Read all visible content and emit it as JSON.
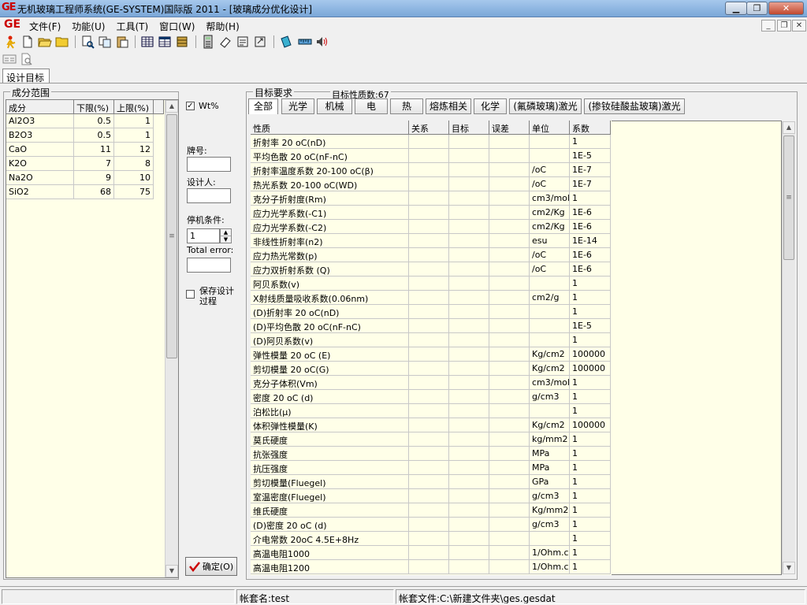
{
  "window": {
    "logo": "GE",
    "title": "无机玻璃工程师系统(GE-SYSTEM)国际版 2011 - [玻璃成分优化设计]"
  },
  "menu": {
    "logo": "GE",
    "items": [
      "文件(F)",
      "功能(U)",
      "工具(T)",
      "窗口(W)",
      "帮助(H)"
    ]
  },
  "tab": {
    "label": "设计目标"
  },
  "composition": {
    "group_title": "成分范围",
    "headers": [
      "成分",
      "下限(%)",
      "上限(%)"
    ],
    "rows": [
      [
        "Al2O3",
        "0.5",
        "1"
      ],
      [
        "B2O3",
        "0.5",
        "1"
      ],
      [
        "CaO",
        "11",
        "12"
      ],
      [
        "K2O",
        "7",
        "8"
      ],
      [
        "Na2O",
        "9",
        "10"
      ],
      [
        "SiO2",
        "68",
        "75"
      ]
    ]
  },
  "options": {
    "wt_label": "Wt%",
    "wt_checked": "✓",
    "brand_label": "牌号:",
    "brand_value": "",
    "designer_label": "设计人:",
    "designer_value": "",
    "stop_label": "停机条件:",
    "stop_value": "1",
    "error_label": "Total error:",
    "error_value": "",
    "save_label_1": "保存设计",
    "save_label_2": "过程",
    "confirm_label": "确定(O)"
  },
  "target": {
    "group_title": "目标要求",
    "count_text": "目标性质数:67",
    "tabs": [
      "全部",
      "光学",
      "机械",
      "电",
      "热",
      "熔炼相关",
      "化学",
      "(氟磷玻璃)激光",
      "(掺钕硅酸盐玻璃)激光"
    ],
    "headers": [
      "性质",
      "关系",
      "目标",
      "误差",
      "单位",
      "系数"
    ],
    "rows": [
      [
        "折射率 20 oC(nD)",
        "",
        "",
        "",
        "",
        "1"
      ],
      [
        "平均色散 20 oC(nF-nC)",
        "",
        "",
        "",
        "",
        "1E-5"
      ],
      [
        "折射率温度系数 20-100 oC(β)",
        "",
        "",
        "",
        "/oC",
        "1E-7"
      ],
      [
        "热光系数 20-100 oC(WD)",
        "",
        "",
        "",
        "/oC",
        "1E-7"
      ],
      [
        "克分子折射度(Rm)",
        "",
        "",
        "",
        "cm3/mol",
        "1"
      ],
      [
        "应力光学系数(-C1)",
        "",
        "",
        "",
        "cm2/Kg",
        "1E-6"
      ],
      [
        "应力光学系数(-C2)",
        "",
        "",
        "",
        "cm2/Kg",
        "1E-6"
      ],
      [
        "非线性折射率(n2)",
        "",
        "",
        "",
        "esu",
        "1E-14"
      ],
      [
        "应力热光常数(p)",
        "",
        "",
        "",
        "/oC",
        "1E-6"
      ],
      [
        "应力双折射系数 (Q)",
        "",
        "",
        "",
        "/oC",
        "1E-6"
      ],
      [
        "阿贝系数(v)",
        "",
        "",
        "",
        "",
        "1"
      ],
      [
        "X射线质量吸收系数(0.06nm)",
        "",
        "",
        "",
        "cm2/g",
        "1"
      ],
      [
        "(D)折射率 20 oC(nD)",
        "",
        "",
        "",
        "",
        "1"
      ],
      [
        "(D)平均色散 20 oC(nF-nC)",
        "",
        "",
        "",
        "",
        "1E-5"
      ],
      [
        "(D)阿贝系数(v)",
        "",
        "",
        "",
        "",
        "1"
      ],
      [
        "弹性模量 20 oC (E)",
        "",
        "",
        "",
        "Kg/cm2",
        "100000"
      ],
      [
        "剪切模量 20 oC(G)",
        "",
        "",
        "",
        "Kg/cm2",
        "100000"
      ],
      [
        "克分子体积(Vm)",
        "",
        "",
        "",
        "cm3/mol",
        "1"
      ],
      [
        "密度 20 oC  (d)",
        "",
        "",
        "",
        "g/cm3",
        "1"
      ],
      [
        "泊松比(μ)",
        "",
        "",
        "",
        "",
        "1"
      ],
      [
        "体积弹性模量(K)",
        "",
        "",
        "",
        "Kg/cm2",
        "100000"
      ],
      [
        "莫氏硬度",
        "",
        "",
        "",
        "kg/mm2",
        "1"
      ],
      [
        "抗张强度",
        "",
        "",
        "",
        "MPa",
        "1"
      ],
      [
        "抗压强度",
        "",
        "",
        "",
        "MPa",
        "1"
      ],
      [
        "剪切模量(Fluegel)",
        "",
        "",
        "",
        "GPa",
        "1"
      ],
      [
        "室温密度(Fluegel)",
        "",
        "",
        "",
        "g/cm3",
        "1"
      ],
      [
        "维氏硬度",
        "",
        "",
        "",
        "Kg/mm2",
        "1"
      ],
      [
        "(D)密度 20 oC  (d)",
        "",
        "",
        "",
        "g/cm3",
        "1"
      ],
      [
        "介电常数 20oC 4.5E+8Hz",
        "",
        "",
        "",
        "",
        "1"
      ],
      [
        "高温电阻1000",
        "",
        "",
        "",
        "1/Ohm.cm",
        "1"
      ],
      [
        "高温电阻1200",
        "",
        "",
        "",
        "1/Ohm.cm",
        "1"
      ]
    ]
  },
  "status": {
    "account_name": "帐套名:test",
    "account_file": "帐套文件:C:\\新建文件夹\\ges.gesdat"
  }
}
